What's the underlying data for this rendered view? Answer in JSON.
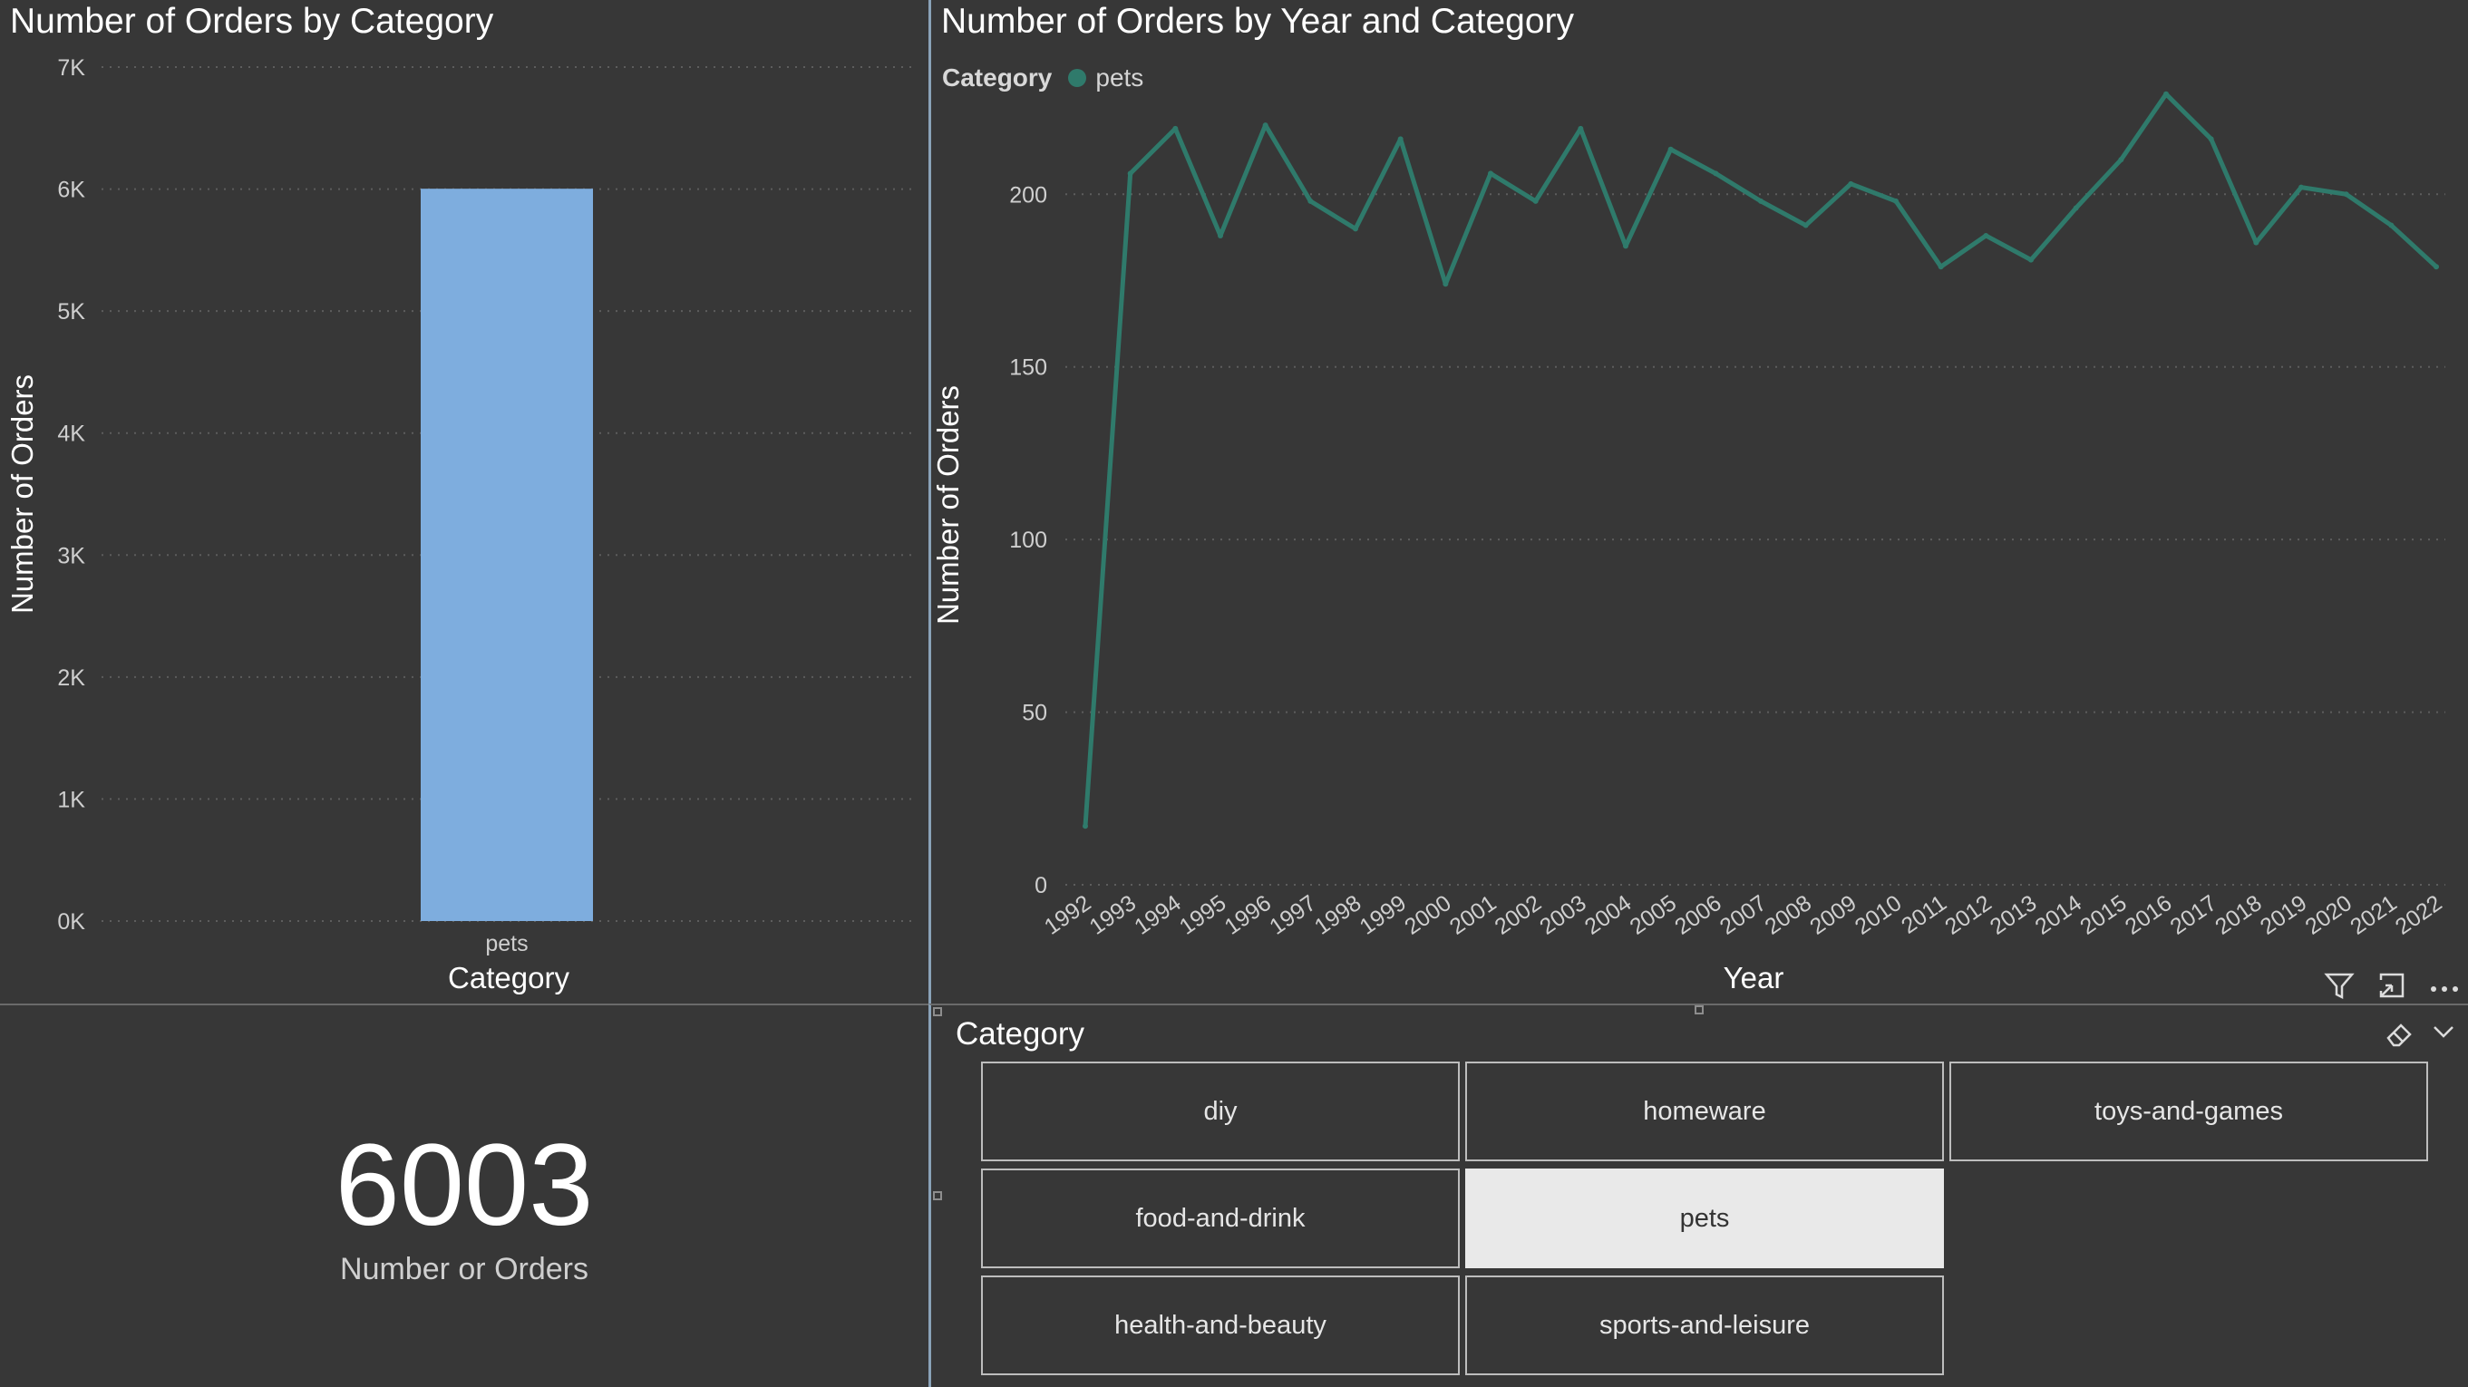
{
  "bar_panel": {
    "title": "Number of Orders by Category"
  },
  "line_panel": {
    "title": "Number of Orders by Year and Category",
    "legend_title": "Category",
    "legend_item": "pets",
    "icons": [
      "filter-icon",
      "focus-mode-icon",
      "more-options-icon"
    ]
  },
  "card": {
    "value": "6003",
    "label": "Number or Orders"
  },
  "slicer": {
    "title": "Category",
    "items": [
      {
        "label": "diy",
        "selected": false
      },
      {
        "label": "homeware",
        "selected": false
      },
      {
        "label": "toys-and-games",
        "selected": false
      },
      {
        "label": "food-and-drink",
        "selected": false
      },
      {
        "label": "pets",
        "selected": true
      },
      {
        "label": "health-and-beauty",
        "selected": false
      },
      {
        "label": "sports-and-leisure",
        "selected": false
      }
    ],
    "icons": [
      "eraser-icon",
      "chevron-down-icon"
    ]
  },
  "colors": {
    "bar": "#7eadde",
    "line": "#2f7a6b",
    "background": "#373737",
    "selected_chip": "#e9e9e9"
  },
  "chart_data": [
    {
      "type": "bar",
      "title": "Number of Orders by Category",
      "xlabel": "Category",
      "ylabel": "Number of Orders",
      "categories": [
        "pets"
      ],
      "values": [
        6003
      ],
      "ylim": [
        0,
        7000
      ],
      "yticks": [
        0,
        1000,
        2000,
        3000,
        4000,
        5000,
        6000,
        7000
      ],
      "ytick_labels": [
        "0K",
        "1K",
        "2K",
        "3K",
        "4K",
        "5K",
        "6K",
        "7K"
      ],
      "grid": true
    },
    {
      "type": "line",
      "title": "Number of Orders by Year and Category",
      "xlabel": "Year",
      "ylabel": "Number of Orders",
      "legend_title": "Category",
      "legend_position": "top-left",
      "x": [
        "1992",
        "1993",
        "1994",
        "1995",
        "1996",
        "1997",
        "1998",
        "1999",
        "2000",
        "2001",
        "2002",
        "2003",
        "2004",
        "2005",
        "2006",
        "2007",
        "2008",
        "2009",
        "2010",
        "2011",
        "2012",
        "2013",
        "2014",
        "2015",
        "2016",
        "2017",
        "2018",
        "2019",
        "2020",
        "2021",
        "2022"
      ],
      "series": [
        {
          "name": "pets",
          "values": [
            17,
            206,
            219,
            188,
            220,
            198,
            190,
            216,
            174,
            206,
            198,
            219,
            185,
            213,
            206,
            198,
            191,
            203,
            198,
            179,
            188,
            181,
            196,
            210,
            229,
            216,
            186,
            202,
            200,
            191,
            179
          ]
        }
      ],
      "ylim": [
        0,
        230
      ],
      "yticks": [
        0,
        50,
        100,
        150,
        200
      ],
      "grid": true
    }
  ]
}
